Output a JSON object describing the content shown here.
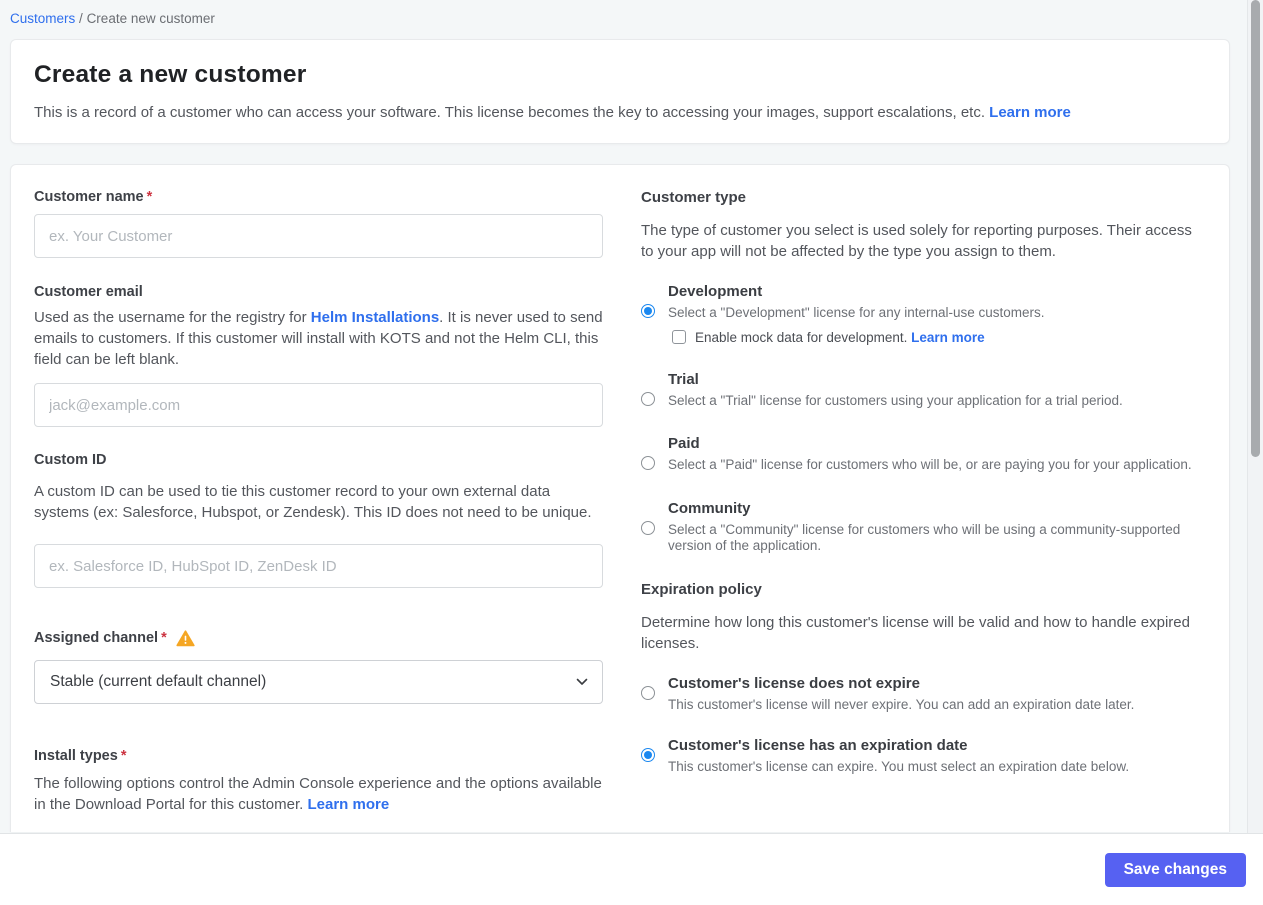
{
  "breadcrumb": {
    "link_label": "Customers",
    "separator": "/",
    "current": "Create new customer"
  },
  "header": {
    "title": "Create a new customer",
    "description": "This is a record of a customer who can access your software. This license becomes the key to accessing your images, support escalations, etc.",
    "learn_more_label": "Learn more"
  },
  "form": {
    "customer_name": {
      "label": "Customer name",
      "required_mark": "*",
      "placeholder": "ex. Your Customer"
    },
    "customer_email": {
      "label": "Customer email",
      "desc_before": "Used as the username for the registry for ",
      "desc_link": "Helm Installations",
      "desc_after": ". It is never used to send emails to customers. If this customer will install with KOTS and not the Helm CLI, this field can be left blank.",
      "placeholder": "jack@example.com"
    },
    "custom_id": {
      "label": "Custom ID",
      "description": "A custom ID can be used to tie this customer record to your own external data systems (ex: Salesforce, Hubspot, or Zendesk). This ID does not need to be unique.",
      "placeholder": "ex. Salesforce ID, HubSpot ID, ZenDesk ID"
    },
    "assigned_channel": {
      "label": "Assigned channel",
      "required_mark": "*",
      "selected_option": "Stable (current default channel)"
    },
    "install_types": {
      "label": "Install types",
      "required_mark": "*",
      "description": "The following options control the Admin Console experience and the options available in the Download Portal for this customer. ",
      "learn_more_label": "Learn more"
    }
  },
  "customer_type": {
    "heading": "Customer type",
    "description": "The type of customer you select is used solely for reporting purposes. Their access to your app will not be affected by the type you assign to them.",
    "options": [
      {
        "label": "Development",
        "description": "Select a \"Development\" license for any internal-use customers.",
        "selected": true,
        "checkbox": {
          "label": "Enable mock data for development. ",
          "link_label": "Learn more",
          "checked": false
        }
      },
      {
        "label": "Trial",
        "description": "Select a \"Trial\" license for customers using your application for a trial period.",
        "selected": false
      },
      {
        "label": "Paid",
        "description": "Select a \"Paid\" license for customers who will be, or are paying you for your application.",
        "selected": false
      },
      {
        "label": "Community",
        "description": "Select a \"Community\" license for customers who will be using a community-supported version of the application.",
        "selected": false
      }
    ]
  },
  "expiration_policy": {
    "heading": "Expiration policy",
    "description": "Determine how long this customer's license will be valid and how to handle expired licenses.",
    "options": [
      {
        "label": "Customer's license does not expire",
        "description": "This customer's license will never expire. You can add an expiration date later.",
        "selected": false
      },
      {
        "label": "Customer's license has an expiration date",
        "description": "This customer's license can expire. You must select an expiration date below.",
        "selected": true
      }
    ]
  },
  "footer": {
    "save_label": "Save changes"
  },
  "colors": {
    "link_blue": "#2f6fed",
    "radio_blue": "#1b88f0",
    "save_button": "#5661f2",
    "warning_amber": "#f5a623",
    "required_red": "#cc3340",
    "page_background": "#f4f7f8"
  }
}
